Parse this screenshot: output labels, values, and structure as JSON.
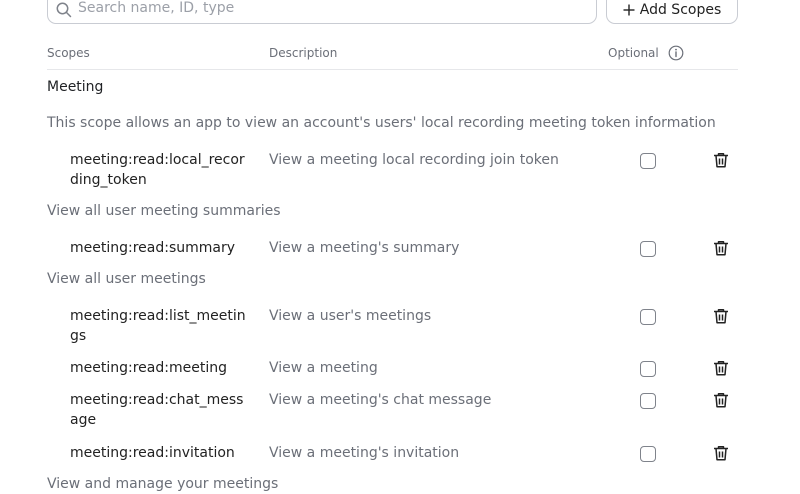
{
  "search": {
    "placeholder": "Search name, ID, type"
  },
  "toolbar": {
    "add_label": "Add Scopes"
  },
  "table": {
    "col_scopes": "Scopes",
    "col_description": "Description",
    "col_optional": "Optional"
  },
  "group": {
    "title": "Meeting",
    "sections": [
      {
        "text": "This scope allows an app to view an account's users' local recording meeting token information"
      },
      {
        "text": "View all user meeting summaries"
      },
      {
        "text": "View all user meetings"
      },
      {
        "text": "View and manage your meetings"
      }
    ],
    "rows": [
      {
        "scope": "meeting:read:local_recording_token",
        "description": "View a meeting local recording join token"
      },
      {
        "scope": "meeting:read:summary",
        "description": "View a meeting's summary"
      },
      {
        "scope": "meeting:read:list_meetings",
        "description": "View a user's meetings"
      },
      {
        "scope": "meeting:read:meeting",
        "description": "View a meeting"
      },
      {
        "scope": "meeting:read:chat_message",
        "description": "View a meeting's chat message"
      },
      {
        "scope": "meeting:read:invitation",
        "description": "View a meeting's invitation"
      }
    ]
  },
  "icons": {
    "search": "search-icon",
    "add": "plus-icon",
    "info": "info-icon",
    "delete": "trash-icon"
  },
  "colors": {
    "muted_text": "#6b6f78",
    "border": "#c9ccd3"
  }
}
